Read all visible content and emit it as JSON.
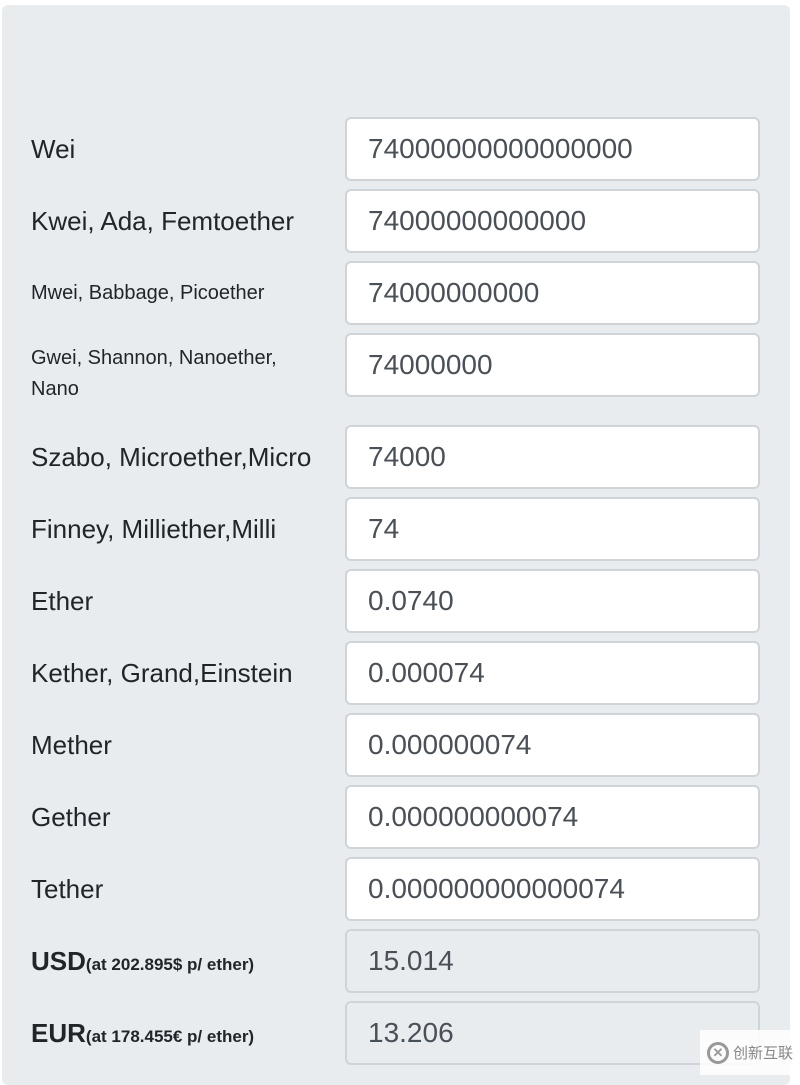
{
  "units": [
    {
      "label": "Wei",
      "value": "74000000000000000"
    },
    {
      "label": "Kwei, Ada, Femtoether",
      "value": "74000000000000"
    },
    {
      "label": "Mwei, Babbage, Picoether",
      "value": "74000000000"
    },
    {
      "label": "Gwei, Shannon, Nanoether, Nano",
      "value": "74000000"
    },
    {
      "label": "Szabo, Microether,Micro",
      "value": "74000"
    },
    {
      "label": "Finney, Milliether,Milli",
      "value": "74"
    },
    {
      "label": "Ether",
      "value": "0.0740"
    },
    {
      "label": "Kether, Grand,Einstein",
      "value": "0.000074"
    },
    {
      "label": "Mether",
      "value": "0.000000074"
    },
    {
      "label": "Gether",
      "value": "0.000000000074"
    },
    {
      "label": "Tether",
      "value": "0.000000000000074"
    }
  ],
  "fiat": [
    {
      "currency": "USD",
      "note": "(at 202.895$ p/ ether)",
      "value": "15.014"
    },
    {
      "currency": "EUR",
      "note": "(at 178.455€ p/ ether)",
      "value": "13.206"
    }
  ],
  "watermark": "创新互联"
}
